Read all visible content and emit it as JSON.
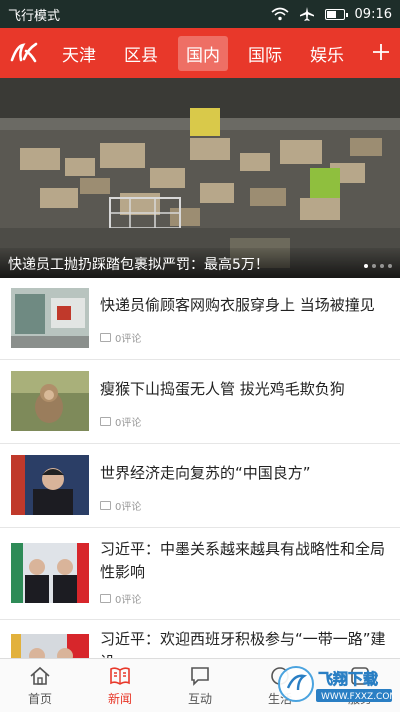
{
  "status_bar": {
    "mode": "飞行模式",
    "time": "09:16"
  },
  "tabs": [
    {
      "label": "天津",
      "active": false
    },
    {
      "label": "区县",
      "active": false
    },
    {
      "label": "国内",
      "active": true
    },
    {
      "label": "国际",
      "active": false
    },
    {
      "label": "娱乐",
      "active": false
    }
  ],
  "hero": {
    "caption": "快递员工抛扔踩踏包裹拟严罚：最高5万！"
  },
  "news": [
    {
      "title": "快递员偷顾客网购衣服穿身上 当场被撞见",
      "comments": "0评论"
    },
    {
      "title": "瘦猴下山捣蛋无人管 拔光鸡毛欺负狗",
      "comments": "0评论"
    },
    {
      "title": "世界经济走向复苏的“中国良方”",
      "comments": "0评论"
    },
    {
      "title": "习近平：中墨关系越来越具有战略性和全局性影响",
      "comments": "0评论"
    },
    {
      "title": "习近平：欢迎西班牙积极参与“一带一路”建设",
      "comments": ""
    }
  ],
  "bottom_nav": [
    {
      "label": "首页",
      "icon": "home-icon",
      "active": false
    },
    {
      "label": "新闻",
      "icon": "news-icon",
      "active": true
    },
    {
      "label": "互动",
      "icon": "chat-icon",
      "active": false
    },
    {
      "label": "生活",
      "icon": "life-icon",
      "active": false
    },
    {
      "label": "服务",
      "icon": "service-icon",
      "active": false
    }
  ],
  "watermark": {
    "text": "飞翔下载",
    "url": "WWW.FXXZ.COM"
  },
  "colors": {
    "accent": "#e8382a",
    "status_bar": "#1e2e2a"
  }
}
